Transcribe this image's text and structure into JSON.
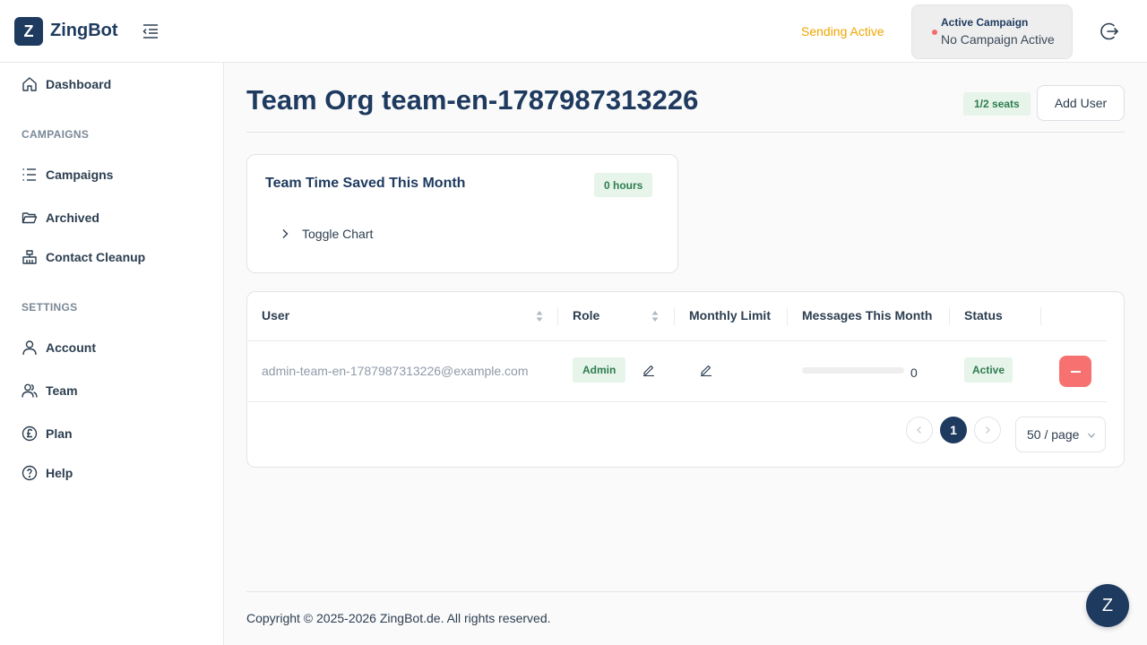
{
  "app": {
    "logo_letter": "Z",
    "name": "ZingBot"
  },
  "header": {
    "sending_status": "Sending Active",
    "campaign_label": "Active Campaign",
    "campaign_value": "No Campaign Active",
    "status_dot_color": "#f56c6c",
    "warning_color": "#f0a500"
  },
  "sidebar": {
    "dashboard": "Dashboard",
    "campaigns_section": "CAMPAIGNS",
    "campaigns": "Campaigns",
    "archived": "Archived",
    "contact_cleanup": "Contact Cleanup",
    "settings_section": "SETTINGS",
    "account": "Account",
    "team": "Team",
    "plan": "Plan",
    "help": "Help"
  },
  "main": {
    "title": "Team Org team-en-1787987313226",
    "seats": "1/2 seats",
    "add_user": "Add User"
  },
  "time_card": {
    "title": "Team Time Saved This Month",
    "hours": "0 hours",
    "toggle": "Toggle Chart"
  },
  "table": {
    "columns": {
      "user": "User",
      "role": "Role",
      "monthly_limit": "Monthly Limit",
      "messages": "Messages This Month",
      "status": "Status"
    },
    "rows": [
      {
        "email": "admin-team-en-1787987313226@example.com",
        "role": "Admin",
        "messages_progress": 0,
        "messages_count": "0",
        "status": "Active"
      }
    ]
  },
  "pagination": {
    "current_page": "1",
    "page_size": "50 / page"
  },
  "footer": {
    "copyright": "Copyright © 2025-2026 ZingBot.de. All rights reserved."
  },
  "chat": {
    "letter": "Z"
  },
  "colors": {
    "brand": "#1e3a5f",
    "danger": "#f87171",
    "success_bg": "#e6f4ea",
    "success_text": "#2e7d4f"
  }
}
